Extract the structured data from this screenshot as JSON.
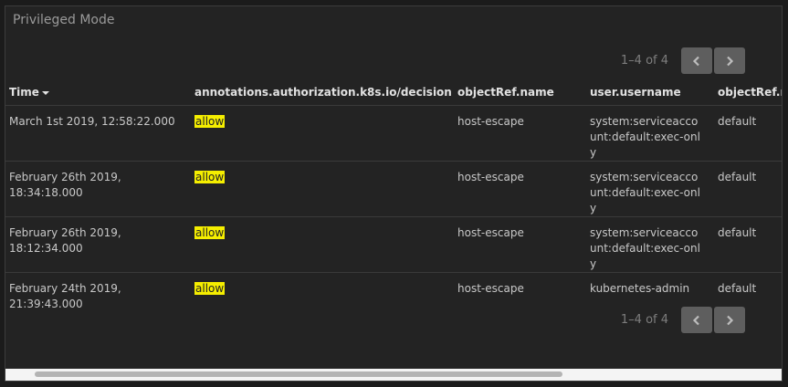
{
  "panel": {
    "title": "Privileged Mode"
  },
  "pager": {
    "range_top": "1–4 of 4",
    "range_bottom": "1–4 of 4",
    "prev_icon": "chevron-left-icon",
    "next_icon": "chevron-right-icon"
  },
  "table": {
    "columns": [
      "Time",
      "annotations.authorization.k8s.io/decision",
      "objectRef.name",
      "user.username",
      "objectRef.namespace"
    ],
    "sort": {
      "column": "Time",
      "direction": "descending"
    },
    "rows": [
      {
        "time": "March 1st 2019, 12:58:22.000",
        "decision": "allow",
        "objectref_name": "host-escape",
        "username": "system:serviceaccount:default:exec-only",
        "namespace": "default"
      },
      {
        "time": "February 26th 2019, 18:34:18.000",
        "decision": "allow",
        "objectref_name": "host-escape",
        "username": "system:serviceaccount:default:exec-only",
        "namespace": "default"
      },
      {
        "time": "February 26th 2019, 18:12:34.000",
        "decision": "allow",
        "objectref_name": "host-escape",
        "username": "system:serviceaccount:default:exec-only",
        "namespace": "default"
      },
      {
        "time": "February 24th 2019, 21:39:43.000",
        "decision": "allow",
        "objectref_name": "host-escape",
        "username": "kubernetes-admin",
        "namespace": "default"
      }
    ]
  },
  "colors": {
    "highlight": "#f5ee00",
    "panel_bg": "#232323",
    "button_bg": "#5e5e5e"
  }
}
